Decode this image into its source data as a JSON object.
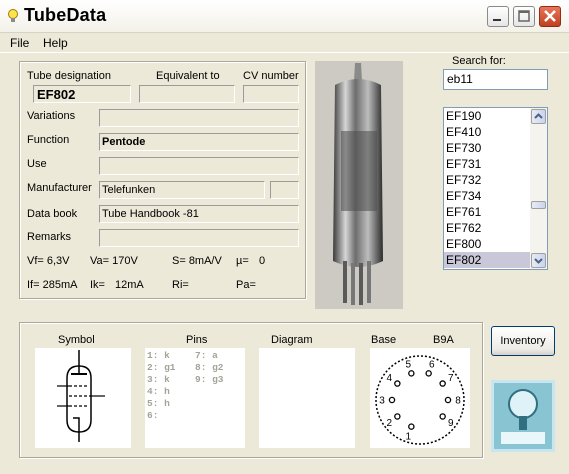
{
  "window": {
    "title": "TubeData"
  },
  "menu": {
    "file": "File",
    "help": "Help"
  },
  "form": {
    "tube_designation_label": "Tube designation",
    "equivalent_label": "Equivalent to",
    "cv_label": "CV number",
    "tube_designation": "EF802",
    "equivalent": "",
    "cv_number": "",
    "variations_label": "Variations",
    "variations": "",
    "function_label": "Function",
    "function": "Pentode",
    "use_label": "Use",
    "use": "",
    "manufacturer_label": "Manufacturer",
    "manufacturer": "Telefunken",
    "manufacturer_extra": "",
    "databook_label": "Data book",
    "databook": "Tube Handbook -81",
    "remarks_label": "Remarks",
    "remarks": "",
    "params": {
      "vf": "Vf= 6,3V",
      "va": "Va= 170V",
      "s": "S= 8mA/V",
      "mu": "µ=",
      "mu_val": "0",
      "if": "If= 285mA",
      "ik": "Ik=",
      "ik_val": "12mA",
      "ri": "Ri=",
      "pa": "Pa="
    }
  },
  "search": {
    "label": "Search for:",
    "value": "eb11",
    "list": [
      "EF190",
      "EF410",
      "EF730",
      "EF731",
      "EF732",
      "EF734",
      "EF761",
      "EF762",
      "EF800",
      "EF802"
    ],
    "selected": "EF802"
  },
  "bottom": {
    "symbol_label": "Symbol",
    "pins_label": "Pins",
    "diagram_label": "Diagram",
    "base_label": "Base",
    "base_type": "B9A",
    "pins_col1": [
      "1: k",
      "2: g1",
      "3: k",
      "4: h",
      "5: h",
      "6:"
    ],
    "pins_col2": [
      "7: a",
      "8: g2",
      "9: g3"
    ],
    "base_numbers": [
      "1",
      "2",
      "3",
      "4",
      "5",
      "6",
      "7",
      "8",
      "9"
    ]
  },
  "buttons": {
    "inventory": "Inventory"
  },
  "icons": [
    "lightbulb-icon",
    "minimize-icon",
    "maximize-icon",
    "close-icon",
    "scroll-up-icon",
    "scroll-down-icon",
    "tube-logo-icon"
  ],
  "colors": {
    "close_red": "#c1401f",
    "selection": "#c8c8d8",
    "input_border": "#7f9db9"
  }
}
